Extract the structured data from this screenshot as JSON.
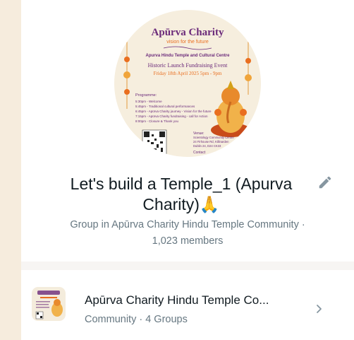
{
  "group": {
    "avatar_texts": {
      "brand": "Apūrva Charity",
      "tagline": "vision for the future",
      "temple": "Apurva Hindu Temple and Cultural Centre",
      "event": "Historic Launch Fundraising Event",
      "date": "Friday 18th April 2025 5pm - 9pm",
      "programme_heading": "Programme:",
      "programme": [
        "5:30pm - Welcome",
        "5:45pm - Traditional cultural performances",
        "6:45pm - Apūrva Charity journey - Vision for the future",
        "7:15pm - Apūrva Charity fundraising - call for Action",
        "8:00pm - Closure & Thank you"
      ],
      "venue_heading": "Venue:",
      "venue": [
        "Scientology Community Centre",
        "24 Firhouse Rd, Killinarden",
        "Dublin 24, D24 CK33"
      ],
      "contact_heading": "Contact"
    },
    "title": "Let's build a Temple_1 (Apurva Charity)🙏",
    "subtitle_line1": "Group in Apūrva Charity Hindu Temple Community ·",
    "subtitle_line2": "1,023 members"
  },
  "community": {
    "name": "Apūrva Charity Hindu Temple Co...",
    "meta": "Community · 4 Groups"
  },
  "colors": {
    "page_bg": "#f6ecdd",
    "text_primary": "#111b21",
    "text_secondary": "#667781",
    "icon": "#8696a0",
    "accent_orange": "#e96e1f",
    "accent_purple": "#6b2a7a"
  },
  "icons": {
    "edit": "pencil-icon",
    "chevron": "chevron-right-icon"
  }
}
